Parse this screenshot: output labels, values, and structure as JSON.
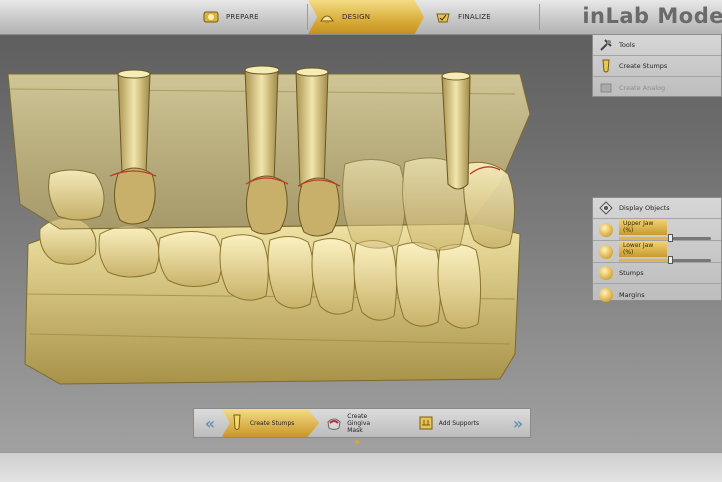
{
  "app": {
    "brand": "inLab Mode"
  },
  "workflow": {
    "steps": [
      {
        "label": "PREPARE",
        "icon": "prepare-icon",
        "active": false
      },
      {
        "label": "DESIGN",
        "icon": "design-icon",
        "active": true
      },
      {
        "label": "FINALIZE",
        "icon": "finalize-icon",
        "active": false
      }
    ]
  },
  "panel_top": {
    "items": [
      {
        "label": "Tools",
        "icon": "tools-icon",
        "enabled": true
      },
      {
        "label": "Create Stumps",
        "icon": "stump-icon",
        "enabled": true
      },
      {
        "label": "Create Analog",
        "icon": "analog-icon",
        "enabled": false
      }
    ]
  },
  "panel_display": {
    "header": "Display Objects",
    "upper": {
      "label": "Upper Jaw (%)",
      "value": 55
    },
    "lower": {
      "label": "Lower Jaw (%)",
      "value": 55
    },
    "items": [
      {
        "label": "Stumps",
        "icon": "stumps-icon"
      },
      {
        "label": "Margins",
        "icon": "margins-icon"
      }
    ]
  },
  "toolbar": {
    "prev_label": "«",
    "next_label": "»",
    "tools": [
      {
        "label": "Create Stumps",
        "icon": "stump-icon",
        "active": true
      },
      {
        "label": "Create Gingiva Mask",
        "icon": "gingiva-mask-icon",
        "active": false
      },
      {
        "label": "Add Supports",
        "icon": "support-icon",
        "active": false
      }
    ]
  },
  "colors": {
    "accent_gold": "#d9ad3a",
    "model_yellow": "#e3d38a",
    "margin_red": "#c0392b"
  }
}
